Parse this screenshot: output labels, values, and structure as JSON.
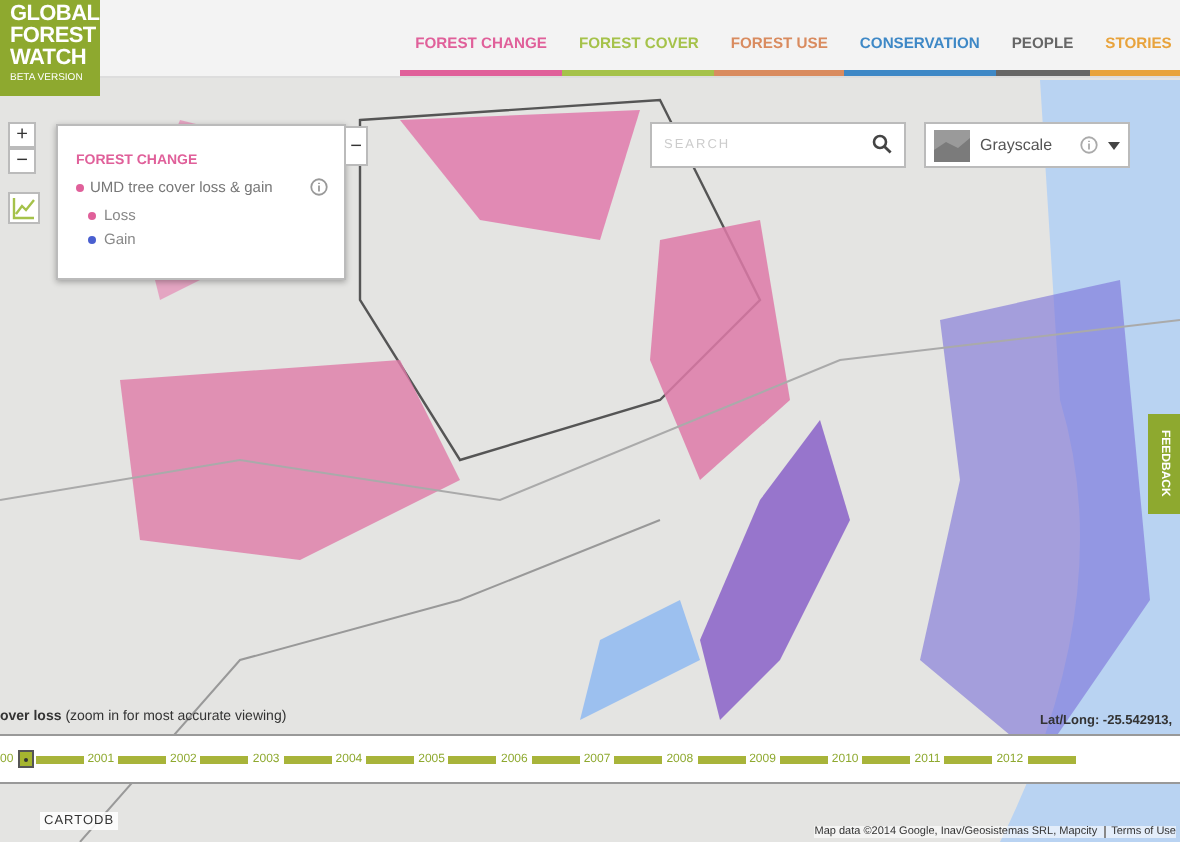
{
  "logo": {
    "lines": [
      "GLOBAL",
      "FOREST",
      "WATCH"
    ],
    "subtitle": "BETA VERSION"
  },
  "nav": [
    {
      "label": "FOREST CHANGE",
      "color": "#e0609a"
    },
    {
      "label": "FOREST COVER",
      "color": "#a5c24a"
    },
    {
      "label": "FOREST USE",
      "color": "#d98b5f"
    },
    {
      "label": "CONSERVATION",
      "color": "#3e88c6"
    },
    {
      "label": "PEOPLE",
      "color": "#666666"
    },
    {
      "label": "STORIES",
      "color": "#e8a33c"
    }
  ],
  "map_controls": {
    "zoom_in": "+",
    "zoom_out": "−"
  },
  "legend": {
    "collapse": "−",
    "title": "FOREST CHANGE",
    "layer": "UMD tree cover loss & gain",
    "items": [
      {
        "label": "Loss",
        "color": "#e0609a"
      },
      {
        "label": "Gain",
        "color": "#4a5fd0"
      }
    ]
  },
  "search": {
    "placeholder": "SEARCH"
  },
  "basemap": {
    "label": "Grayscale"
  },
  "feedback": "FEEDBACK",
  "caption": "**over loss** (zoom in for most accurate viewing)",
  "coordinates": "Lat/Long: -25.542913,",
  "timeline": {
    "start": "00",
    "years": [
      "2001",
      "2002",
      "2003",
      "2004",
      "2005",
      "2006",
      "2007",
      "2008",
      "2009",
      "2010",
      "2011",
      "2012"
    ]
  },
  "cartodb": "CARTODB",
  "attribution": "Map data ©2014 Google, Inav/Geosistemas SRL, Mapcity",
  "terms": "Terms of Use"
}
